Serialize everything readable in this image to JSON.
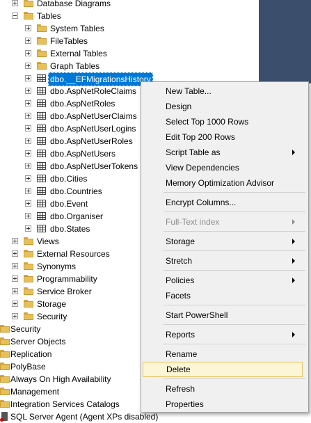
{
  "tree": {
    "items": [
      {
        "label": "Database Diagrams",
        "icon": "folder-icon",
        "expander": "plus"
      },
      {
        "label": "Tables",
        "icon": "folder-icon",
        "expander": "minus"
      },
      {
        "label": "System Tables",
        "icon": "folder-icon",
        "expander": "plus"
      },
      {
        "label": "FileTables",
        "icon": "folder-icon",
        "expander": "plus"
      },
      {
        "label": "External Tables",
        "icon": "folder-icon",
        "expander": "plus"
      },
      {
        "label": "Graph Tables",
        "icon": "folder-icon",
        "expander": "plus"
      },
      {
        "label": "dbo.__EFMigrationsHistory",
        "icon": "table-icon",
        "expander": "plus",
        "selected": true
      },
      {
        "label": "dbo.AspNetRoleClaims",
        "icon": "table-icon",
        "expander": "plus"
      },
      {
        "label": "dbo.AspNetRoles",
        "icon": "table-icon",
        "expander": "plus"
      },
      {
        "label": "dbo.AspNetUserClaims",
        "icon": "table-icon",
        "expander": "plus"
      },
      {
        "label": "dbo.AspNetUserLogins",
        "icon": "table-icon",
        "expander": "plus"
      },
      {
        "label": "dbo.AspNetUserRoles",
        "icon": "table-icon",
        "expander": "plus"
      },
      {
        "label": "dbo.AspNetUsers",
        "icon": "table-icon",
        "expander": "plus"
      },
      {
        "label": "dbo.AspNetUserTokens",
        "icon": "table-icon",
        "expander": "plus"
      },
      {
        "label": "dbo.Cities",
        "icon": "table-icon",
        "expander": "plus"
      },
      {
        "label": "dbo.Countries",
        "icon": "table-icon",
        "expander": "plus"
      },
      {
        "label": "dbo.Event",
        "icon": "table-icon",
        "expander": "plus"
      },
      {
        "label": "dbo.Organiser",
        "icon": "table-icon",
        "expander": "plus"
      },
      {
        "label": "dbo.States",
        "icon": "table-icon",
        "expander": "plus"
      },
      {
        "label": "Views",
        "icon": "folder-icon",
        "expander": "plus"
      },
      {
        "label": "External Resources",
        "icon": "folder-icon",
        "expander": "plus"
      },
      {
        "label": "Synonyms",
        "icon": "folder-icon",
        "expander": "plus"
      },
      {
        "label": "Programmability",
        "icon": "folder-icon",
        "expander": "plus"
      },
      {
        "label": "Service Broker",
        "icon": "folder-icon",
        "expander": "plus"
      },
      {
        "label": "Storage",
        "icon": "folder-icon",
        "expander": "plus"
      },
      {
        "label": "Security",
        "icon": "folder-icon",
        "expander": "plus"
      },
      {
        "label": "Security",
        "icon": "folder-icon"
      },
      {
        "label": "Server Objects",
        "icon": "folder-icon"
      },
      {
        "label": "Replication",
        "icon": "folder-icon"
      },
      {
        "label": "PolyBase",
        "icon": "folder-icon"
      },
      {
        "label": "Always On High Availability",
        "icon": "folder-icon"
      },
      {
        "label": "Management",
        "icon": "folder-icon"
      },
      {
        "label": "Integration Services Catalogs",
        "icon": "folder-icon"
      },
      {
        "label": "SQL Server Agent (Agent XPs disabled)",
        "icon": "sql-agent-icon"
      }
    ]
  },
  "context_menu": {
    "items": [
      {
        "label": "New Table..."
      },
      {
        "label": "Design"
      },
      {
        "label": "Select Top 1000 Rows"
      },
      {
        "label": "Edit Top 200 Rows"
      },
      {
        "label": "Script Table as",
        "submenu": true
      },
      {
        "label": "View Dependencies"
      },
      {
        "label": "Memory Optimization Advisor"
      },
      {
        "separator": true
      },
      {
        "label": "Encrypt Columns..."
      },
      {
        "separator": true
      },
      {
        "label": "Full-Text index",
        "submenu": true,
        "disabled": true
      },
      {
        "separator": true
      },
      {
        "label": "Storage",
        "submenu": true
      },
      {
        "separator": true
      },
      {
        "label": "Stretch",
        "submenu": true
      },
      {
        "separator": true
      },
      {
        "label": "Policies",
        "submenu": true
      },
      {
        "label": "Facets"
      },
      {
        "separator": true
      },
      {
        "label": "Start PowerShell"
      },
      {
        "separator": true
      },
      {
        "label": "Reports",
        "submenu": true
      },
      {
        "separator": true
      },
      {
        "label": "Rename"
      },
      {
        "label": "Delete",
        "highlighted": true
      },
      {
        "separator": true
      },
      {
        "label": "Refresh"
      },
      {
        "label": "Properties"
      }
    ]
  },
  "colors": {
    "selection": "#0078d7",
    "menu_background": "#f0f0f0",
    "menu_highlight": "#fcf6d6",
    "side_panel": "#3b4f6c"
  }
}
